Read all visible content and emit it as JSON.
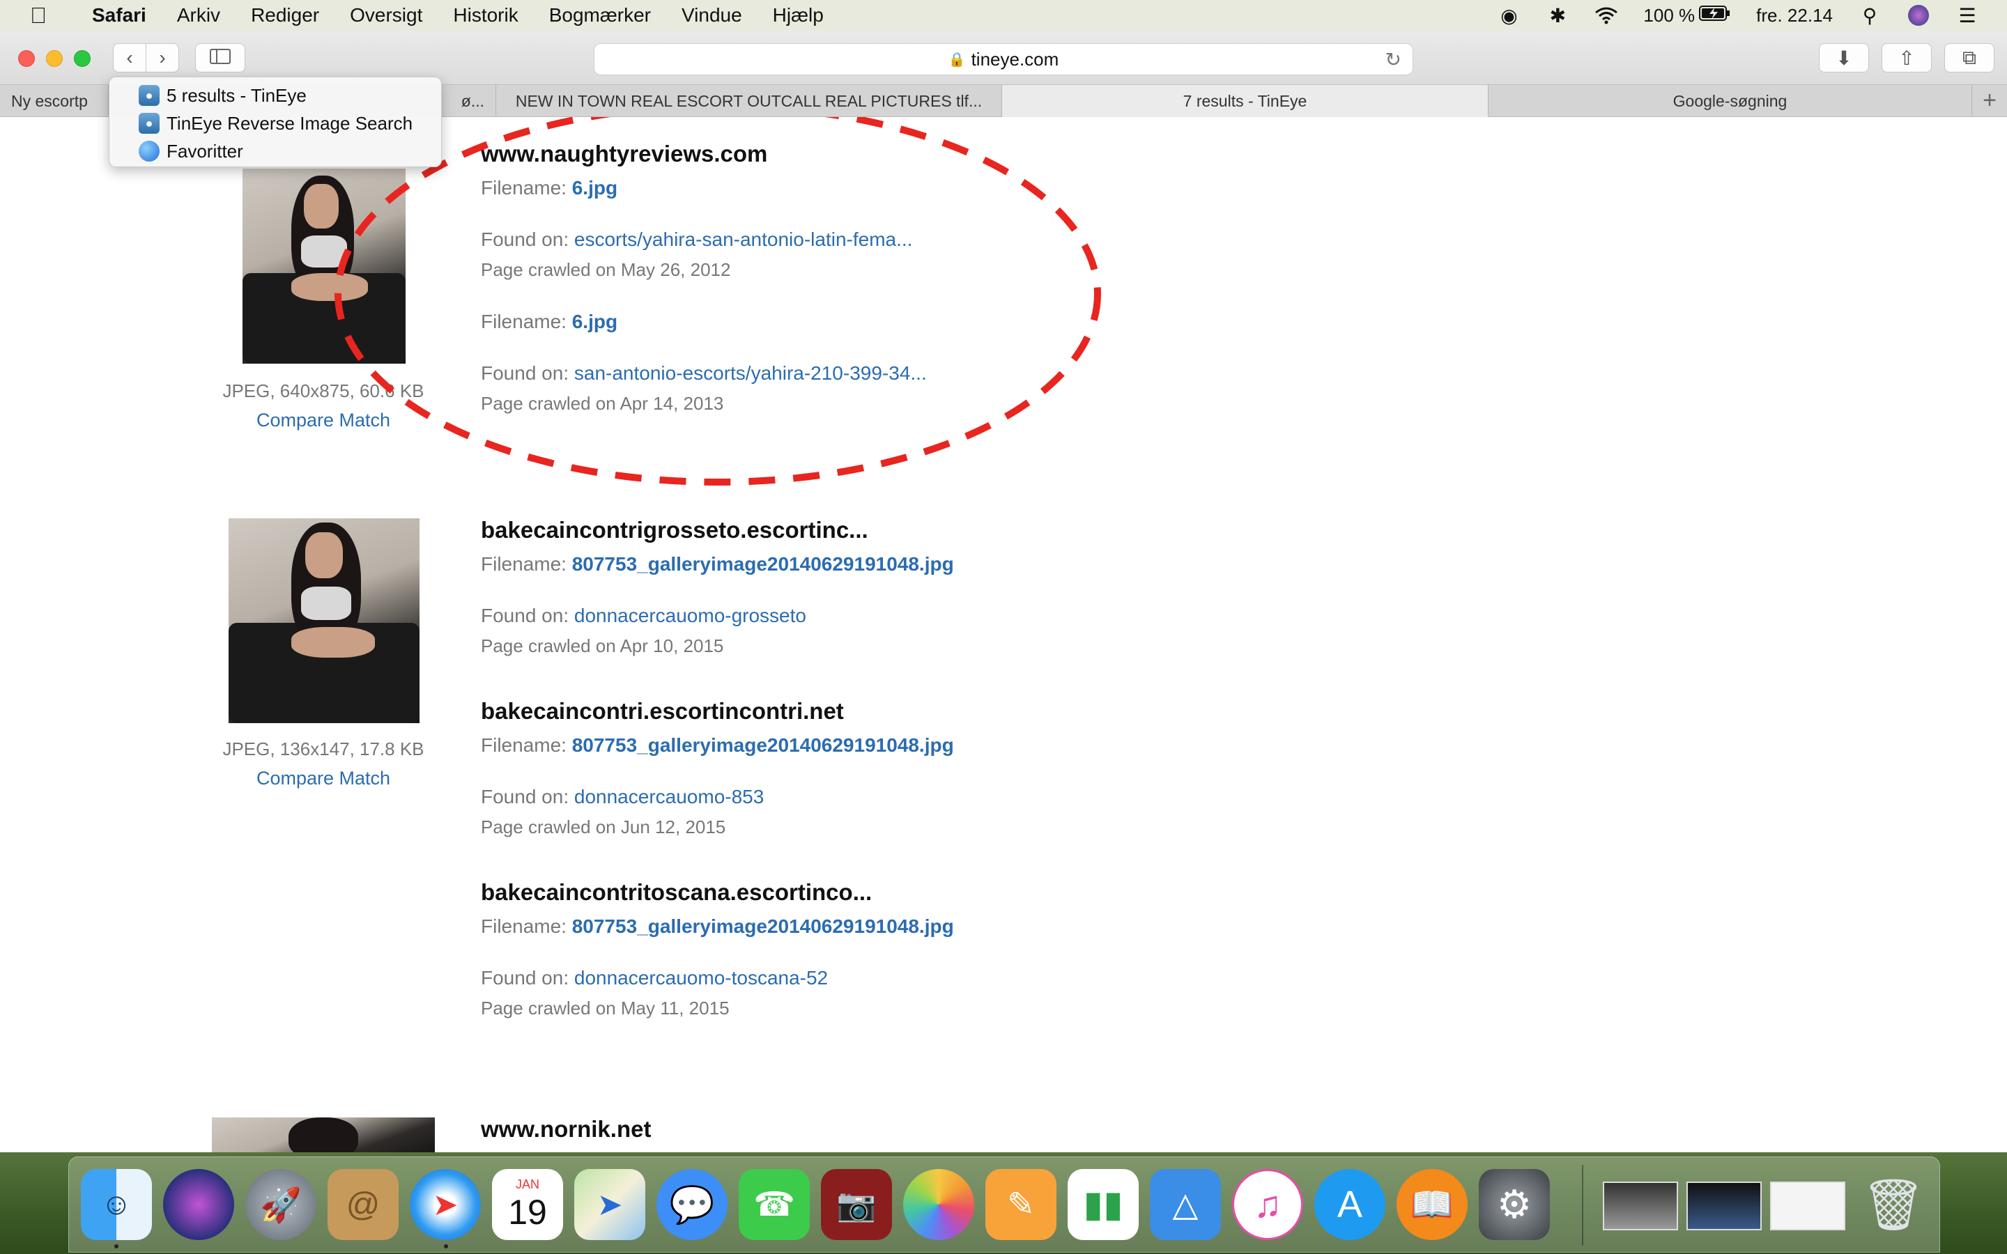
{
  "menubar": {
    "app_name": "Safari",
    "items": [
      "Arkiv",
      "Rediger",
      "Oversigt",
      "Historik",
      "Bogmærker",
      "Vindue",
      "Hjælp"
    ],
    "battery": "100 %",
    "clock": "fre. 22.14"
  },
  "toolbar": {
    "url": "tineye.com"
  },
  "tabs": [
    {
      "label": "Ny escortp",
      "active": false
    },
    {
      "label": "ø...",
      "active": false
    },
    {
      "label": "NEW IN TOWN REAL ESCORT OUTCALL REAL PICTURES tlf...",
      "active": false
    },
    {
      "label": "7 results - TinEye",
      "active": true
    },
    {
      "label": "Google-søgning",
      "active": false
    }
  ],
  "dropdown": {
    "items": [
      {
        "label": "5 results - TinEye",
        "icon": "tineye-icon"
      },
      {
        "label": "TinEye Reverse Image Search",
        "icon": "tineye-icon"
      },
      {
        "label": "Favoritter",
        "icon": "globe-icon"
      }
    ]
  },
  "results": [
    {
      "image_meta": "JPEG, 640x875, 60.6 KB",
      "compare_label": "Compare Match",
      "sites": [
        {
          "domain": "www.naughtyreviews.com",
          "entries": [
            {
              "filename_label": "Filename:",
              "filename": "6.jpg",
              "found_label": "Found on:",
              "found_on": "escorts/yahira-san-antonio-latin-fema...",
              "crawled": "Page crawled on May 26, 2012"
            },
            {
              "filename_label": "Filename:",
              "filename": "6.jpg",
              "found_label": "Found on:",
              "found_on": "san-antonio-escorts/yahira-210-399-34...",
              "crawled": "Page crawled on Apr 14, 2013"
            }
          ]
        }
      ]
    },
    {
      "image_meta": "JPEG, 136x147, 17.8 KB",
      "compare_label": "Compare Match",
      "sites": [
        {
          "domain": "bakecaincontrigrosseto.escortinc...",
          "entries": [
            {
              "filename_label": "Filename:",
              "filename": "807753_galleryimage20140629191048.jpg",
              "found_label": "Found on:",
              "found_on": "donnacercauomo-grosseto",
              "crawled": "Page crawled on Apr 10, 2015"
            }
          ]
        },
        {
          "domain": "bakecaincontri.escortincontri.net",
          "entries": [
            {
              "filename_label": "Filename:",
              "filename": "807753_galleryimage20140629191048.jpg",
              "found_label": "Found on:",
              "found_on": "donnacercauomo-853",
              "crawled": "Page crawled on Jun 12, 2015"
            }
          ]
        },
        {
          "domain": "bakecaincontritoscana.escortinco...",
          "entries": [
            {
              "filename_label": "Filename:",
              "filename": "807753_galleryimage20140629191048.jpg",
              "found_label": "Found on:",
              "found_on": "donnacercauomo-toscana-52",
              "crawled": "Page crawled on May 11, 2015"
            }
          ]
        }
      ]
    },
    {
      "sites": [
        {
          "domain": "www.nornik.net"
        }
      ]
    }
  ],
  "annotation": {
    "color": "#e8251f",
    "style": "dashed-ellipse"
  },
  "dock": {
    "calendar_month": "JAN",
    "calendar_day": "19",
    "apps": [
      "finder-icon",
      "siri-icon",
      "launchpad-icon",
      "contacts-icon",
      "safari-icon",
      "calendar-icon",
      "maps-icon",
      "messages-icon",
      "facetime-icon",
      "photo-booth-icon",
      "photos-icon",
      "pages-icon",
      "numbers-icon",
      "keynote-icon",
      "itunes-icon",
      "app-store-icon",
      "ibooks-icon",
      "system-preferences-icon",
      "trash-icon"
    ]
  }
}
